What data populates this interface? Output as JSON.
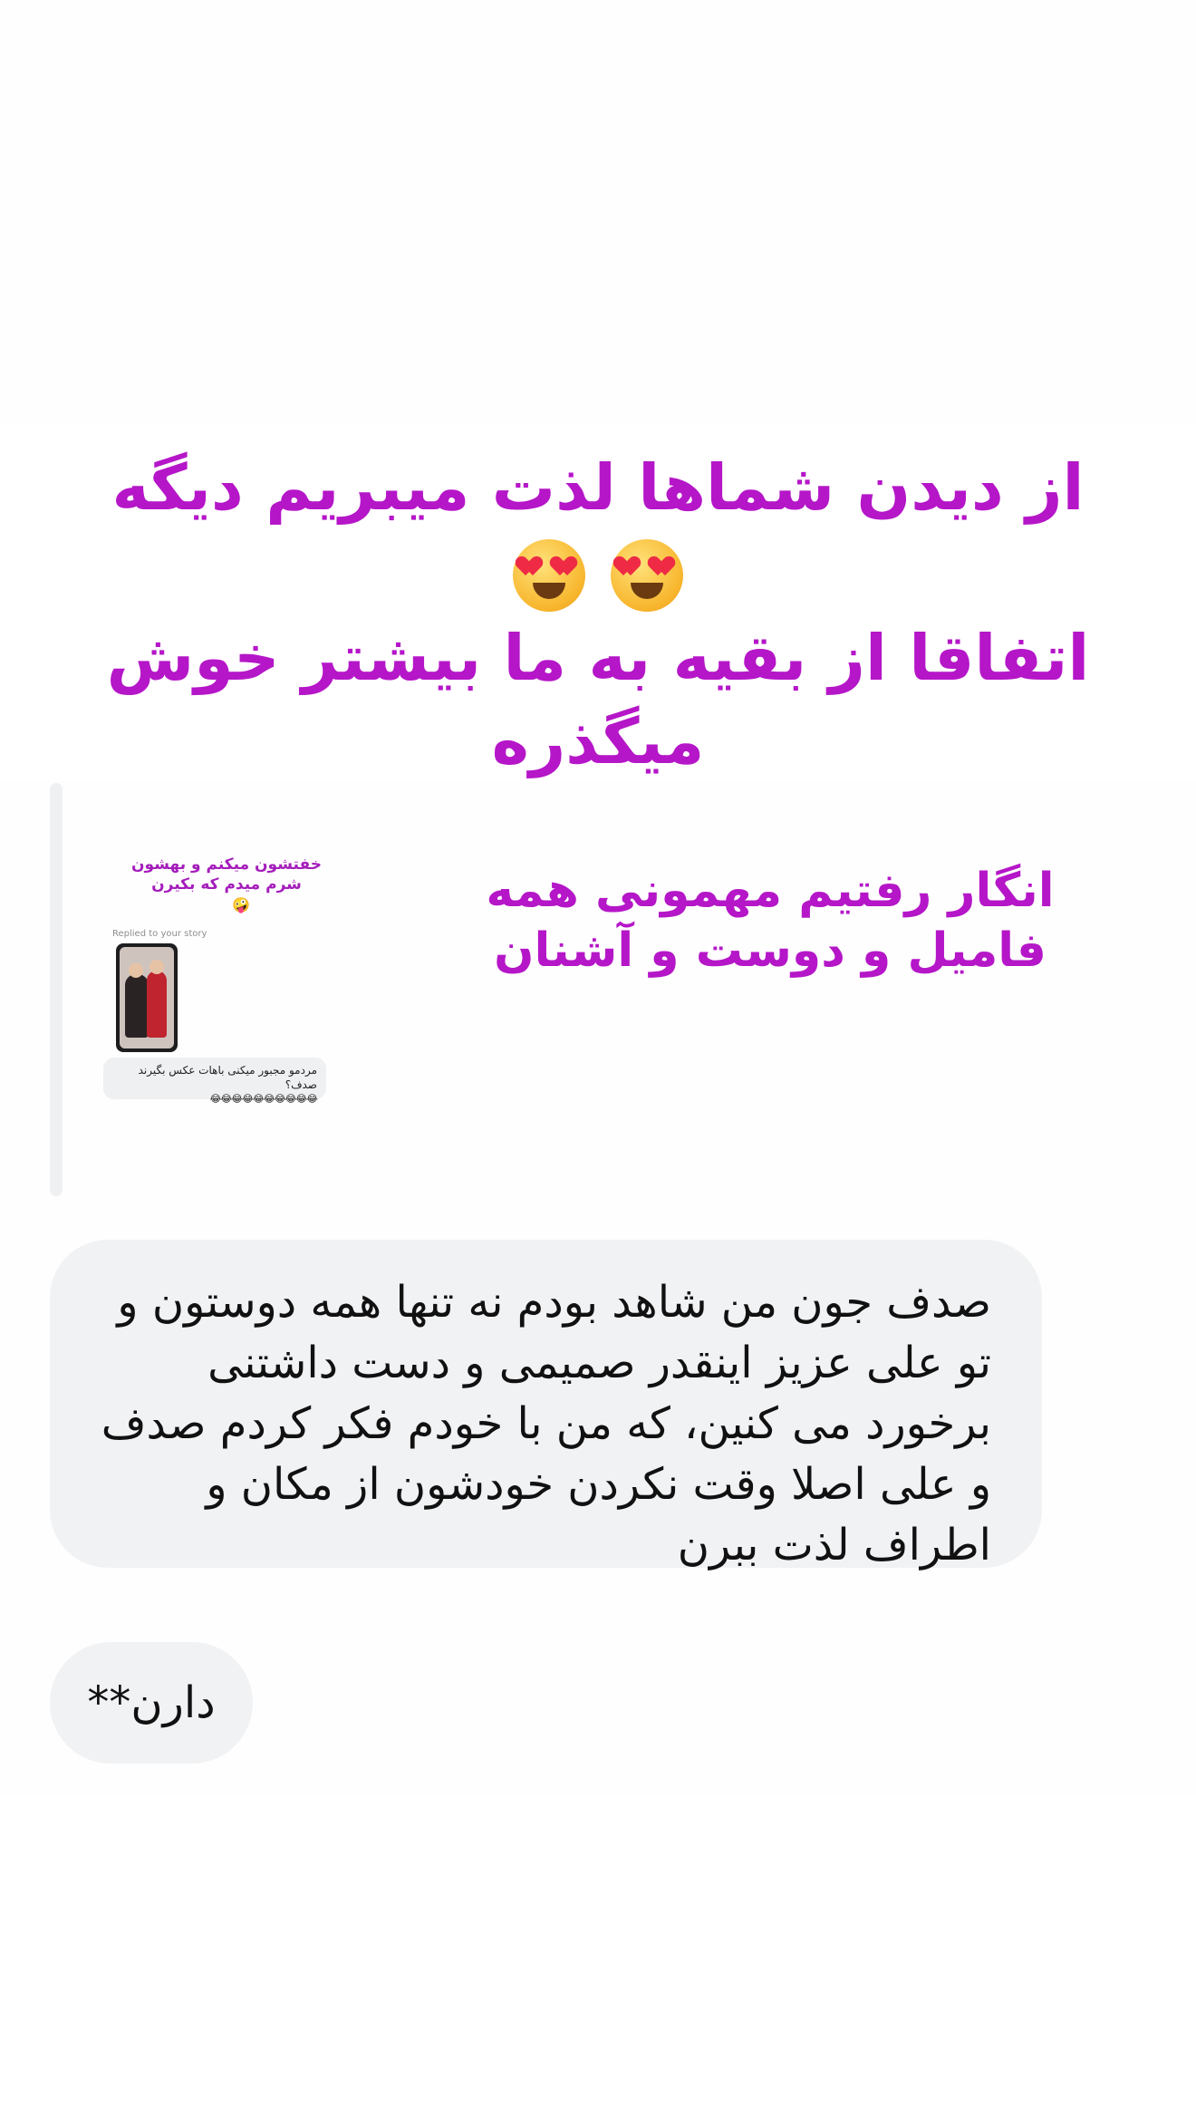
{
  "headline": {
    "line1": "از دیدن شماها لذت میبریم دیگه",
    "line2": "اتفاقا از بقیه به ما بیشتر خوش",
    "line3": "میگذره"
  },
  "story": {
    "caption": "خفتشون میکنم و بهشون شرم میدم که بکیرن",
    "caption_emoji": "🤪",
    "replied_label": "Replied to your story",
    "reply_text": "مردمو مجبور میکنی باهات عکس بگیرند صدف؟",
    "reply_emojis": "😂😂😂😂😂😂😂😂😂😂"
  },
  "side_text": "انگار رفتیم مهمونی همه فامیل و دوست و آشنان",
  "messages": [
    {
      "text": "صدف جون من شاهد بودم نه تنها همه دوستون و تو علی عزیز اینقدر صمیمی و دست داشتنی برخورد می کنین، که من با خودم فکر کردم صدف و علی اصلا وقت نکردن خودشون از مکان و اطراف لذت ببرن"
    },
    {
      "text": "دارن**"
    }
  ],
  "icons": {
    "emoji": "smiling-face-with-heart-eyes"
  },
  "colors": {
    "accent": "#b516c8",
    "bubble_bg": "#f1f2f4",
    "reply_bar": "#eff0f2"
  }
}
